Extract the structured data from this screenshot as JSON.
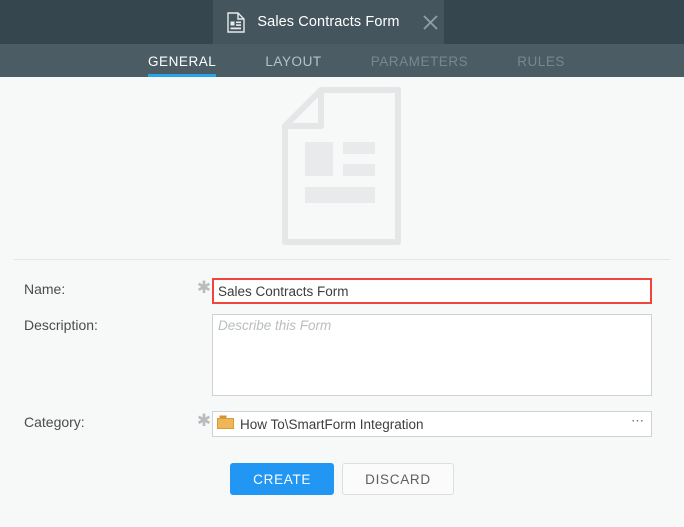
{
  "titlebar": {
    "tab": {
      "icon": "form-document-icon",
      "title": "Sales Contracts Form",
      "close_icon": "close-icon"
    }
  },
  "navbar": {
    "tabs": [
      {
        "label": "GENERAL",
        "state": "active"
      },
      {
        "label": "LAYOUT",
        "state": "normal"
      },
      {
        "label": "PARAMETERS",
        "state": "disabled"
      },
      {
        "label": "RULES",
        "state": "disabled"
      }
    ]
  },
  "preview": {
    "icon": "form-document-preview-icon"
  },
  "form": {
    "name": {
      "label": "Name:",
      "required_marker": "✱",
      "value": "Sales Contracts Form",
      "placeholder": ""
    },
    "description": {
      "label": "Description:",
      "value": "",
      "placeholder": "Describe this Form"
    },
    "category": {
      "label": "Category:",
      "required_marker": "✱",
      "icon": "folder-icon",
      "value": "How To\\SmartForm Integration",
      "browse_label": "⋯"
    }
  },
  "actions": {
    "create_label": "CREATE",
    "discard_label": "DISCARD"
  },
  "colors": {
    "titlebar_bg": "#36464f",
    "tab_bg": "#44555e",
    "navbar_bg": "#4c5c65",
    "accent_blue": "#29a4e8",
    "primary_button": "#2196f3",
    "error_border": "#f0443c",
    "folder": "#e5a23f",
    "content_bg": "#f7f8f8"
  }
}
